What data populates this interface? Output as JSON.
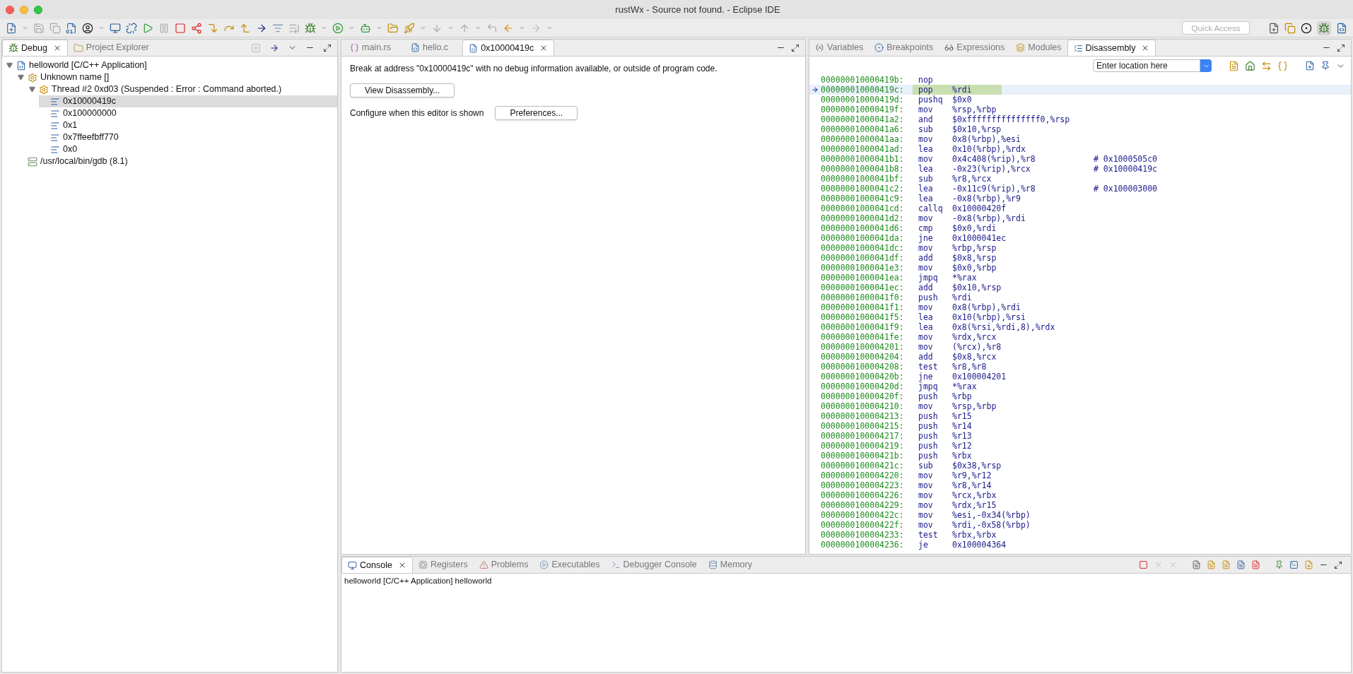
{
  "window": {
    "title": "rustWx - Source not found. - Eclipse IDE"
  },
  "quick_access": {
    "placeholder": "Quick Access"
  },
  "debug_view": {
    "tabs": [
      {
        "label": "Debug",
        "selected": true
      },
      {
        "label": "Project Explorer",
        "selected": false
      }
    ],
    "tree": [
      {
        "kind": "launch",
        "label": "helloworld [C/C++ Application]",
        "selected": false,
        "expanded": true,
        "children": [
          {
            "kind": "process",
            "label": "Unknown name []",
            "selected": false,
            "expanded": true,
            "children": [
              {
                "kind": "thread",
                "label": "Thread #2 0xd03 (Suspended : Error : Command aborted.)",
                "selected": false,
                "expanded": true,
                "children": [
                  {
                    "kind": "frame",
                    "label": "0x10000419c",
                    "selected": true
                  },
                  {
                    "kind": "frame",
                    "label": "0x100000000",
                    "selected": false
                  },
                  {
                    "kind": "frame",
                    "label": "0x1",
                    "selected": false
                  },
                  {
                    "kind": "frame",
                    "label": "0x7ffeefbff770",
                    "selected": false
                  },
                  {
                    "kind": "frame",
                    "label": "0x0",
                    "selected": false
                  }
                ]
              }
            ]
          },
          {
            "kind": "gdb",
            "label": "/usr/local/bin/gdb (8.1)",
            "selected": false
          }
        ]
      }
    ]
  },
  "editor": {
    "tabs": [
      {
        "label": "main.rs",
        "kind": "rust",
        "selected": false
      },
      {
        "label": "hello.c",
        "kind": "c",
        "selected": false
      },
      {
        "label": "0x10000419c",
        "kind": "c",
        "selected": true
      }
    ],
    "message": "Break at address \"0x10000419c\" with no debug information available, or outside of program code.",
    "view_button": "View Disassembly...",
    "configure_label": "Configure when this editor is shown",
    "preferences_button": "Preferences..."
  },
  "right_view": {
    "tabs": [
      {
        "label": "Variables",
        "selected": false
      },
      {
        "label": "Breakpoints",
        "selected": false
      },
      {
        "label": "Expressions",
        "selected": false
      },
      {
        "label": "Modules",
        "selected": false
      },
      {
        "label": "Disassembly",
        "selected": true
      }
    ],
    "location_field": {
      "placeholder": "Enter location here"
    },
    "rows": [
      {
        "address": "000000010000419b:",
        "mnemonic": "nop",
        "operands": "",
        "current": false
      },
      {
        "address": "000000010000419c:",
        "mnemonic": "pop",
        "operands": "%rdi",
        "current": true
      },
      {
        "address": "000000010000419d:",
        "mnemonic": "pushq",
        "operands": "$0x0",
        "current": false
      },
      {
        "address": "000000010000419f:",
        "mnemonic": "mov",
        "operands": "%rsp,%rbp",
        "current": false
      },
      {
        "address": "00000001000041a2:",
        "mnemonic": "and",
        "operands": "$0xfffffffffffffff0,%rsp",
        "current": false
      },
      {
        "address": "00000001000041a6:",
        "mnemonic": "sub",
        "operands": "$0x10,%rsp",
        "current": false
      },
      {
        "address": "00000001000041aa:",
        "mnemonic": "mov",
        "operands": "0x8(%rbp),%esi",
        "current": false
      },
      {
        "address": "00000001000041ad:",
        "mnemonic": "lea",
        "operands": "0x10(%rbp),%rdx",
        "current": false
      },
      {
        "address": "00000001000041b1:",
        "mnemonic": "mov",
        "operands": "0x4c408(%rip),%r8",
        "comment": "# 0x1000505c0",
        "current": false
      },
      {
        "address": "00000001000041b8:",
        "mnemonic": "lea",
        "operands": "-0x23(%rip),%rcx",
        "comment": "# 0x10000419c",
        "current": false
      },
      {
        "address": "00000001000041bf:",
        "mnemonic": "sub",
        "operands": "%r8,%rcx",
        "current": false
      },
      {
        "address": "00000001000041c2:",
        "mnemonic": "lea",
        "operands": "-0x11c9(%rip),%r8",
        "comment": "# 0x100003000",
        "current": false
      },
      {
        "address": "00000001000041c9:",
        "mnemonic": "lea",
        "operands": "-0x8(%rbp),%r9",
        "current": false
      },
      {
        "address": "00000001000041cd:",
        "mnemonic": "callq",
        "operands": "0x10000420f",
        "current": false
      },
      {
        "address": "00000001000041d2:",
        "mnemonic": "mov",
        "operands": "-0x8(%rbp),%rdi",
        "current": false
      },
      {
        "address": "00000001000041d6:",
        "mnemonic": "cmp",
        "operands": "$0x0,%rdi",
        "current": false
      },
      {
        "address": "00000001000041da:",
        "mnemonic": "jne",
        "operands": "0x1000041ec",
        "current": false
      },
      {
        "address": "00000001000041dc:",
        "mnemonic": "mov",
        "operands": "%rbp,%rsp",
        "current": false
      },
      {
        "address": "00000001000041df:",
        "mnemonic": "add",
        "operands": "$0x8,%rsp",
        "current": false
      },
      {
        "address": "00000001000041e3:",
        "mnemonic": "mov",
        "operands": "$0x0,%rbp",
        "current": false
      },
      {
        "address": "00000001000041ea:",
        "mnemonic": "jmpq",
        "operands": "*%rax",
        "current": false
      },
      {
        "address": "00000001000041ec:",
        "mnemonic": "add",
        "operands": "$0x10,%rsp",
        "current": false
      },
      {
        "address": "00000001000041f0:",
        "mnemonic": "push",
        "operands": "%rdi",
        "current": false
      },
      {
        "address": "00000001000041f1:",
        "mnemonic": "mov",
        "operands": "0x8(%rbp),%rdi",
        "current": false
      },
      {
        "address": "00000001000041f5:",
        "mnemonic": "lea",
        "operands": "0x10(%rbp),%rsi",
        "current": false
      },
      {
        "address": "00000001000041f9:",
        "mnemonic": "lea",
        "operands": "0x8(%rsi,%rdi,8),%rdx",
        "current": false
      },
      {
        "address": "00000001000041fe:",
        "mnemonic": "mov",
        "operands": "%rdx,%rcx",
        "current": false
      },
      {
        "address": "0000000100004201:",
        "mnemonic": "mov",
        "operands": "(%rcx),%r8",
        "current": false
      },
      {
        "address": "0000000100004204:",
        "mnemonic": "add",
        "operands": "$0x8,%rcx",
        "current": false
      },
      {
        "address": "0000000100004208:",
        "mnemonic": "test",
        "operands": "%r8,%r8",
        "current": false
      },
      {
        "address": "000000010000420b:",
        "mnemonic": "jne",
        "operands": "0x100004201",
        "current": false
      },
      {
        "address": "000000010000420d:",
        "mnemonic": "jmpq",
        "operands": "*%rax",
        "current": false
      },
      {
        "address": "000000010000420f:",
        "mnemonic": "push",
        "operands": "%rbp",
        "current": false
      },
      {
        "address": "0000000100004210:",
        "mnemonic": "mov",
        "operands": "%rsp,%rbp",
        "current": false
      },
      {
        "address": "0000000100004213:",
        "mnemonic": "push",
        "operands": "%r15",
        "current": false
      },
      {
        "address": "0000000100004215:",
        "mnemonic": "push",
        "operands": "%r14",
        "current": false
      },
      {
        "address": "0000000100004217:",
        "mnemonic": "push",
        "operands": "%r13",
        "current": false
      },
      {
        "address": "0000000100004219:",
        "mnemonic": "push",
        "operands": "%r12",
        "current": false
      },
      {
        "address": "000000010000421b:",
        "mnemonic": "push",
        "operands": "%rbx",
        "current": false
      },
      {
        "address": "000000010000421c:",
        "mnemonic": "sub",
        "operands": "$0x38,%rsp",
        "current": false
      },
      {
        "address": "0000000100004220:",
        "mnemonic": "mov",
        "operands": "%r9,%r12",
        "current": false
      },
      {
        "address": "0000000100004223:",
        "mnemonic": "mov",
        "operands": "%r8,%r14",
        "current": false
      },
      {
        "address": "0000000100004226:",
        "mnemonic": "mov",
        "operands": "%rcx,%rbx",
        "current": false
      },
      {
        "address": "0000000100004229:",
        "mnemonic": "mov",
        "operands": "%rdx,%r15",
        "current": false
      },
      {
        "address": "000000010000422c:",
        "mnemonic": "mov",
        "operands": "%esi,-0x34(%rbp)",
        "current": false
      },
      {
        "address": "000000010000422f:",
        "mnemonic": "mov",
        "operands": "%rdi,-0x58(%rbp)",
        "current": false
      },
      {
        "address": "0000000100004233:",
        "mnemonic": "test",
        "operands": "%rbx,%rbx",
        "current": false
      },
      {
        "address": "0000000100004236:",
        "mnemonic": "je",
        "operands": "0x100004364",
        "current": false
      }
    ]
  },
  "console": {
    "tabs": [
      {
        "label": "Console",
        "selected": true
      },
      {
        "label": "Registers",
        "selected": false
      },
      {
        "label": "Problems",
        "selected": false
      },
      {
        "label": "Executables",
        "selected": false
      },
      {
        "label": "Debugger Console",
        "selected": false
      },
      {
        "label": "Memory",
        "selected": false
      }
    ],
    "header": "helloworld [C/C++ Application] helloworld"
  }
}
